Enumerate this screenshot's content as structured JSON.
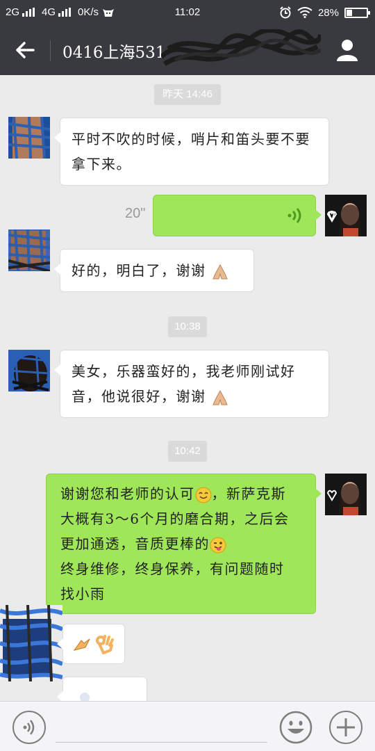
{
  "status_bar": {
    "network1": "2G",
    "network2": "4G",
    "speed": "0K/s",
    "time": "11:02",
    "battery": "28%",
    "battery_level": 0.28
  },
  "header": {
    "title": "0416上海531"
  },
  "messages": {
    "ts1": "昨天 14:46",
    "m1": "平时不吹的时候，哨片和笛头要不要拿下来。",
    "voice_duration": "20\"",
    "m3": "好的，明白了，谢谢",
    "ts2": "10:38",
    "m4": "美女，乐器蛮好的，我老师刚试好音，他说很好，谢谢",
    "ts3": "10:42",
    "m5_l1": "谢谢您和老师的认可",
    "m5_l1b": "，新萨克斯",
    "m5_l2": "大概有3～6个月的磨合期，之后会",
    "m5_l3": "更加通透，音质更棒的",
    "m5_l4": "终身维修，终身保养，有问题随时",
    "m5_l5": "找小雨"
  },
  "colors": {
    "header_bg": "#393a3f",
    "chat_bg": "#ebebeb",
    "outgoing_bubble": "#9fe658",
    "incoming_bubble": "#ffffff"
  },
  "icons": [
    "signal-icon",
    "cow-icon",
    "alarm-icon",
    "wifi-icon",
    "battery-icon",
    "back-arrow-icon",
    "profile-icon",
    "voice-wave-icon",
    "folded-hands-emoji",
    "smile-emoji",
    "wink-tongue-emoji",
    "pinching-hand-emoji",
    "ok-hand-emoji",
    "voice-input-icon",
    "emoji-icon",
    "plus-icon"
  ]
}
